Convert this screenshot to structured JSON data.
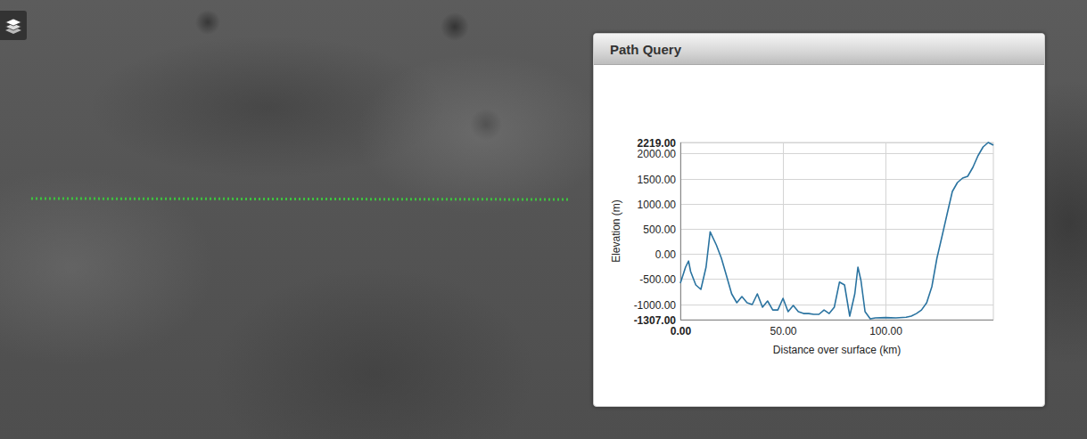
{
  "panel": {
    "title": "Path Query"
  },
  "chart": {
    "y_axis_title": "Elevation (m)",
    "x_axis_title": "Distance over surface (km)",
    "y_ticks": [
      {
        "label": "2219.00",
        "bold": true
      },
      {
        "label": "2000.00",
        "bold": false
      },
      {
        "label": "1500.00",
        "bold": false
      },
      {
        "label": "1000.00",
        "bold": false
      },
      {
        "label": "500.00",
        "bold": false
      },
      {
        "label": "0.00",
        "bold": false
      },
      {
        "label": "-500.00",
        "bold": false
      },
      {
        "label": "-1000.00",
        "bold": false
      },
      {
        "label": "-1307.00",
        "bold": true
      }
    ],
    "x_ticks": [
      {
        "label": "0.00",
        "bold": true
      },
      {
        "label": "50.00",
        "bold": false
      },
      {
        "label": "100.00",
        "bold": false
      }
    ],
    "series": [
      {
        "name": "elevation",
        "distance_km": [
          0,
          2.5,
          4,
          5,
          7.5,
          10,
          12.5,
          14.5,
          17.5,
          20,
          22.5,
          25,
          27.5,
          30,
          32.5,
          35,
          37.5,
          40,
          42.5,
          45,
          47.5,
          50,
          52.5,
          55,
          57.5,
          60,
          62.5,
          65,
          67.5,
          70,
          72.5,
          75,
          77.5,
          80,
          82.5,
          85,
          86.5,
          88,
          90,
          92.5,
          95,
          100,
          105,
          110,
          112.5,
          115,
          117.5,
          120,
          122.5,
          125,
          127.5,
          130,
          132.5,
          135,
          137.5,
          140,
          142.5,
          145,
          147.5,
          150,
          152.5
        ],
        "elevation_m": [
          -580,
          -262,
          -140,
          -350,
          -616,
          -705,
          -262,
          440,
          181,
          -85,
          -439,
          -793,
          -970,
          -846,
          -970,
          -1006,
          -793,
          -1059,
          -935,
          -1113,
          -1113,
          -882,
          -1148,
          -1024,
          -1148,
          -1184,
          -1184,
          -1201,
          -1201,
          -1113,
          -1184,
          -1059,
          -560,
          -616,
          -1237,
          -793,
          -262,
          -527,
          -1148,
          -1290,
          -1272,
          -1265,
          -1272,
          -1260,
          -1237,
          -1184,
          -1113,
          -970,
          -651,
          -85,
          358,
          801,
          1244,
          1422,
          1510,
          1546,
          1723,
          1953,
          2130,
          2219,
          2166
        ]
      }
    ]
  }
}
